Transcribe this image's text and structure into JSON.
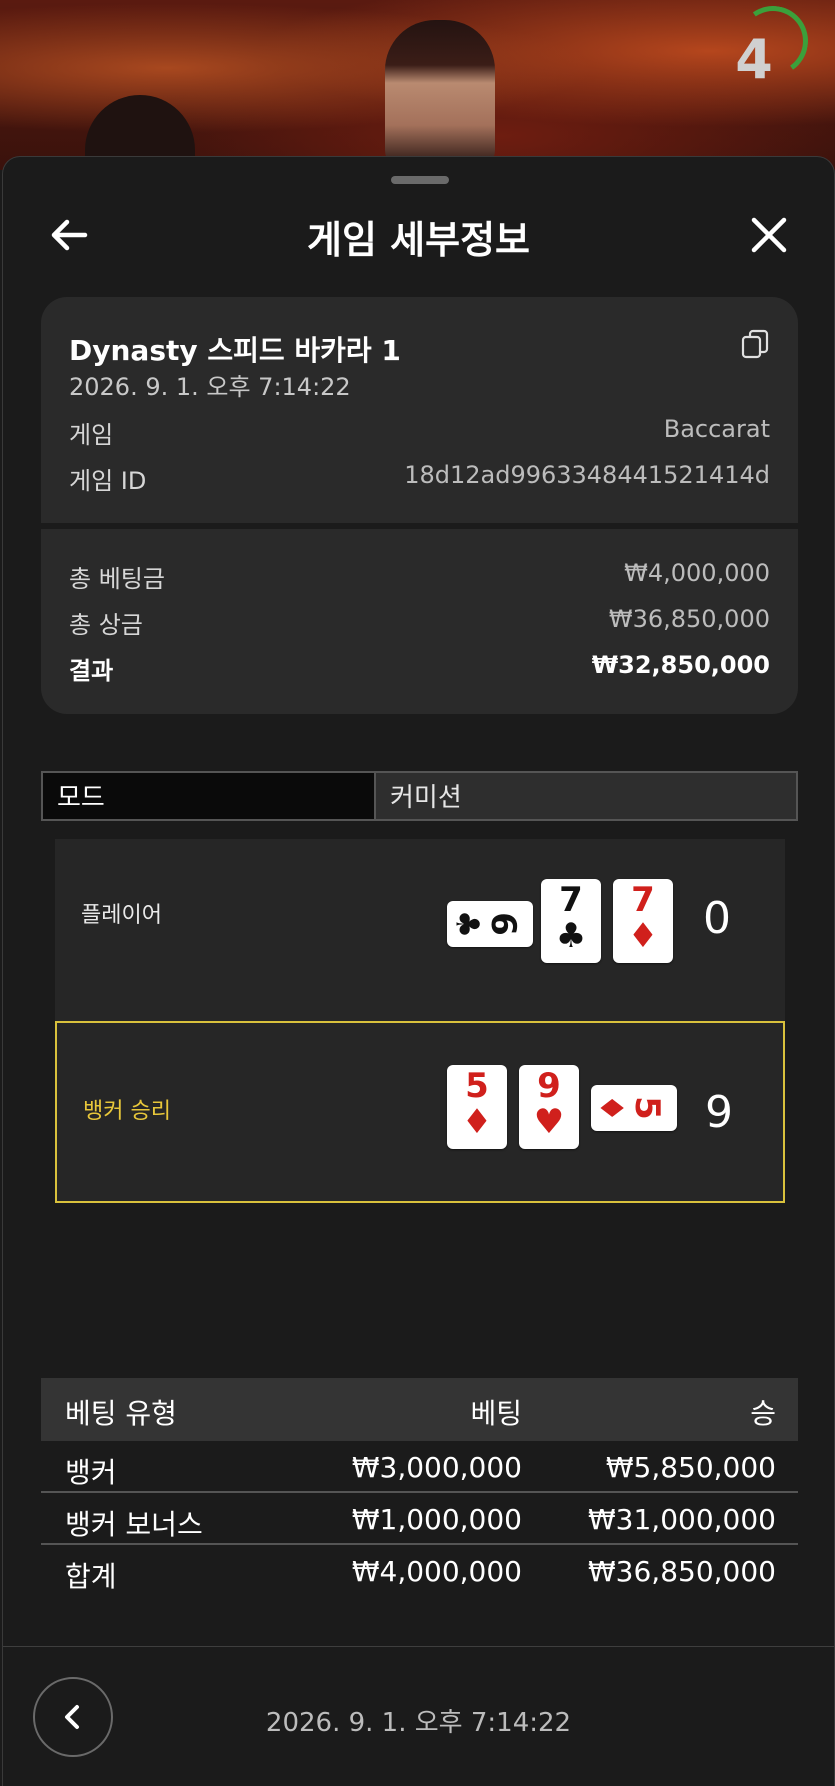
{
  "video": {
    "countdown": "4"
  },
  "header": {
    "title": "게임 세부정보"
  },
  "summary": {
    "game_name": "Dynasty 스피드 바카라 1",
    "datetime": "2026. 9. 1. 오후 7:14:22",
    "rows": [
      {
        "label": "게임",
        "value": "Baccarat"
      },
      {
        "label": "게임 ID",
        "value": "18d12ad9963348441521414d"
      }
    ],
    "totals": [
      {
        "label": "총 베팅금",
        "value": "₩4,000,000"
      },
      {
        "label": "총 상금",
        "value": "₩36,850,000"
      },
      {
        "label": "결과",
        "value": "₩32,850,000"
      }
    ]
  },
  "tabs": {
    "mode": "모드",
    "commission": "커미션"
  },
  "player": {
    "label": "플레이어",
    "score": "0",
    "cards": [
      {
        "rank": "6",
        "suit": "♣",
        "orientation": "horizontal"
      },
      {
        "rank": "7",
        "suit": "♣",
        "orientation": "vertical"
      },
      {
        "rank": "7",
        "suit": "♦",
        "orientation": "vertical"
      }
    ]
  },
  "banker": {
    "label": "뱅커 승리",
    "score": "9",
    "cards": [
      {
        "rank": "5",
        "suit": "♦",
        "orientation": "vertical"
      },
      {
        "rank": "9",
        "suit": "♥",
        "orientation": "vertical"
      },
      {
        "rank": "5",
        "suit": "♦",
        "orientation": "horizontal"
      }
    ]
  },
  "bets_table": {
    "headers": [
      "베팅 유형",
      "베팅",
      "승"
    ],
    "rows": [
      [
        "뱅커",
        "₩3,000,000",
        "₩5,850,000"
      ],
      [
        "뱅커 보너스",
        "₩1,000,000",
        "₩31,000,000"
      ]
    ],
    "total": [
      "합계",
      "₩4,000,000",
      "₩36,850,000"
    ]
  },
  "footer": {
    "datetime": "2026. 9. 1. 오후 7:14:22"
  },
  "colors": {
    "winner_highlight": "#d9c13c",
    "red_suit": "#d0201c",
    "countdown_ring": "#3ba03b"
  },
  "icons": [
    "back-arrow-icon",
    "close-icon",
    "copy-icon",
    "chevron-left-icon",
    "countdown-ring-icon"
  ]
}
